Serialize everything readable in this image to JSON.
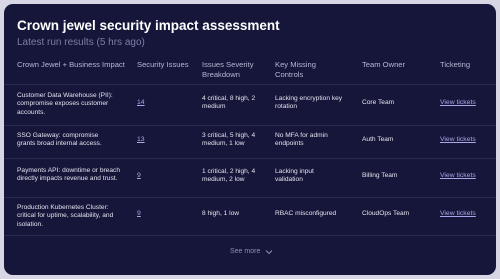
{
  "header": {
    "title": "Crown jewel security impact assessment",
    "subtitle": "Latest run results (5 hrs ago)"
  },
  "table": {
    "columns": [
      "Crown Jewel + Business Impact",
      "Security Issues",
      "Issues Severity Breakdown",
      "Key Missing Controls",
      "Team Owner",
      "Ticketing"
    ],
    "rows": [
      {
        "impact": "Customer Data Warehouse (PII): compromise exposes customer accounts.",
        "issues": "14",
        "severity": "4 critical, 8 high, 2 medium",
        "controls": "Lacking encryption key rotation",
        "owner": "Core Team",
        "ticket": "View tickets"
      },
      {
        "impact": "SSO Gateway: compromise grants broad internal access.",
        "issues": "13",
        "severity": "3 critical, 5 high, 4 medium, 1 low",
        "controls": "No MFA for admin endpoints",
        "owner": "Auth Team",
        "ticket": "View tickets"
      },
      {
        "impact": "Payments API: downtime or breach directly impacts revenue and trust.",
        "issues": "9",
        "severity": "1 critical, 2 high, 4 medium, 2 low",
        "controls": "Lacking input validation",
        "owner": "Billing Team",
        "ticket": "View tickets"
      },
      {
        "impact": "Production Kubernetes Cluster: critical for uptime, scalability, and isolation.",
        "issues": "9",
        "severity": "8 high, 1 low",
        "controls": "RBAC misconfigured",
        "owner": "CloudOps Team",
        "ticket": "View tickets"
      }
    ]
  },
  "footer": {
    "see_more": "See more"
  },
  "colors": {
    "card_background": "#16163a",
    "page_background": "#d8d6e4",
    "link": "#a7a8e8",
    "muted": "#7d7da6"
  },
  "icons": {
    "see_more": "chevron-down-icon"
  }
}
